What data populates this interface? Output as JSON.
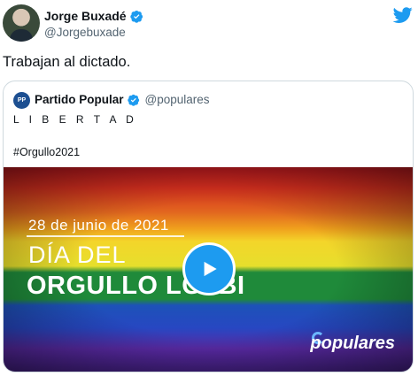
{
  "author": {
    "name": "Jorge Buxadé",
    "handle": "@Jorgebuxade"
  },
  "tweet": {
    "text": "Trabajan al dictado."
  },
  "quoted": {
    "avatar_text": "PP",
    "name": "Partido Popular",
    "handle": "@populares",
    "line1": "L I B E R T A D",
    "line2": "#Orgullo2021",
    "media": {
      "date": "28 de junio de 2021",
      "title_line1": "DÍA DEL",
      "title_line2": "ORGULLO LGTBI",
      "brand": "populares"
    }
  },
  "icons": {
    "verified": "verified-badge-icon",
    "twitter": "twitter-bird-icon",
    "play": "play-icon"
  },
  "colors": {
    "accent": "#1d9bf0",
    "secondary_text": "#536471",
    "border": "#cfd9de"
  }
}
